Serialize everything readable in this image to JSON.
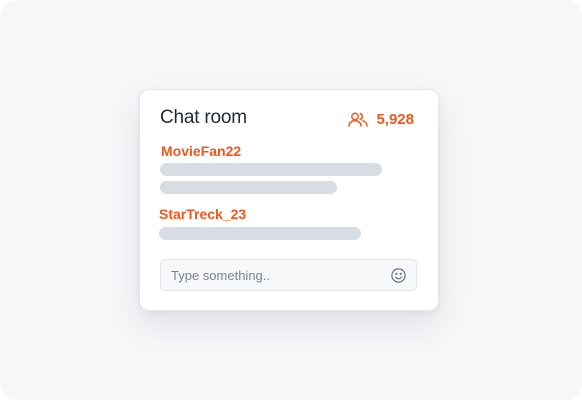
{
  "chat": {
    "title": "Chat room",
    "viewer_count": "5,928",
    "messages": [
      {
        "username": "MovieFan22"
      },
      {
        "username": "StarTreck_23"
      }
    ],
    "input": {
      "placeholder": "Type something.."
    }
  },
  "icons": {
    "viewers": "users-icon",
    "emoji": "smiley-face-icon"
  },
  "colors": {
    "accent": "#ea5a1f",
    "placeholder_bar": "#d8dde3",
    "background": "#f6f7f9",
    "title": "#1f2937"
  }
}
